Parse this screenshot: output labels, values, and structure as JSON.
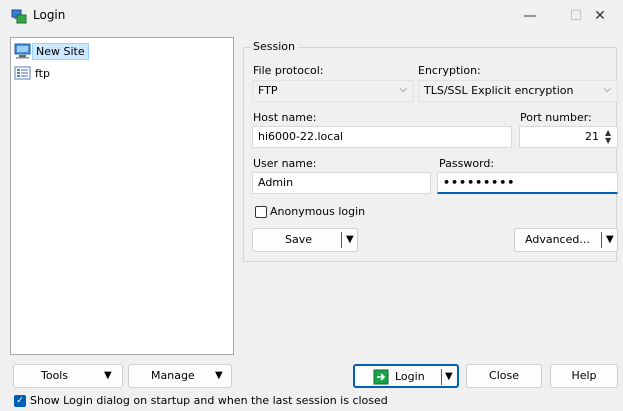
{
  "window": {
    "title": "Login",
    "minimize": "—",
    "maximize": "☐",
    "close": "✕"
  },
  "sites": [
    {
      "label": "New Site",
      "selected": true,
      "icon": "computer-icon"
    },
    {
      "label": "ftp",
      "selected": false,
      "icon": "site-icon"
    }
  ],
  "session": {
    "group_title": "Session",
    "file_protocol_label": "File protocol:",
    "file_protocol_value": "FTP",
    "encryption_label": "Encryption:",
    "encryption_value": "TLS/SSL Explicit encryption",
    "host_label": "Host name:",
    "host_value": "hi6000-22.local",
    "port_label": "Port number:",
    "port_value": "21",
    "user_label": "User name:",
    "user_value": "Admin",
    "password_label": "Password:",
    "password_value": "•••••••••",
    "anonymous_label": "Anonymous login",
    "anonymous_checked": false,
    "save_label": "Save",
    "advanced_label": "Advanced..."
  },
  "bottom": {
    "tools_label": "Tools",
    "manage_label": "Manage",
    "login_label": "Login",
    "close_label": "Close",
    "help_label": "Help",
    "show_dialog_label": "Show Login dialog on startup and when the last session is closed",
    "show_dialog_checked": true
  },
  "colors": {
    "accent": "#005fb8",
    "selection_bg": "#cde8ff"
  }
}
